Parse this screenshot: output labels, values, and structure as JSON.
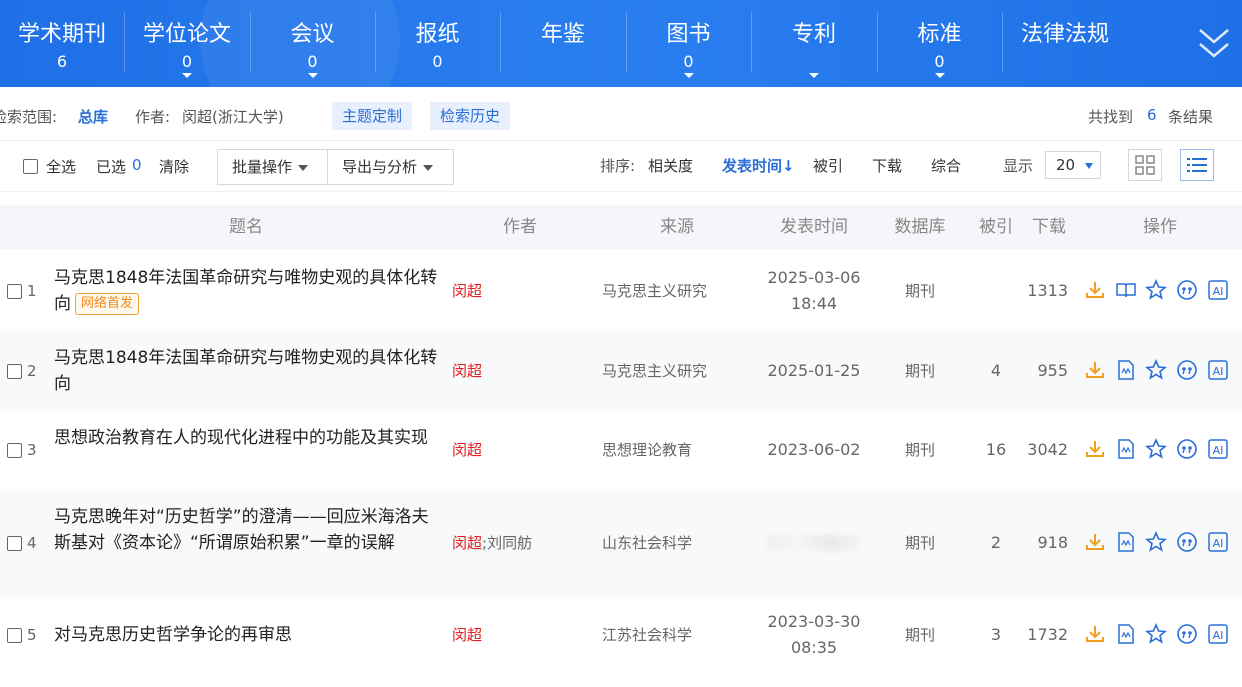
{
  "nav": {
    "tabs": [
      {
        "label": "学术期刊",
        "count": "6",
        "caret": false
      },
      {
        "label": "学位论文",
        "count": "0",
        "caret": true
      },
      {
        "label": "会议",
        "count": "0",
        "caret": true
      },
      {
        "label": "报纸",
        "count": "0",
        "caret": false
      },
      {
        "label": "年鉴",
        "count": "",
        "caret": false
      },
      {
        "label": "图书",
        "count": "0",
        "caret": true
      },
      {
        "label": "专利",
        "count": "",
        "caret": true
      },
      {
        "label": "标准",
        "count": "0",
        "caret": true
      },
      {
        "label": "法律法规",
        "count": "",
        "caret": false
      }
    ],
    "expand_icon": "double-chevron-down-icon"
  },
  "scope": {
    "label": "检索范围:",
    "value": "总库",
    "author_label": "作者:",
    "author_value": "闵超(浙江大学)",
    "topic_button": "主题定制",
    "history_button": "检索历史",
    "result_prefix": "共找到",
    "result_count": "6",
    "result_suffix": "条结果"
  },
  "toolbar": {
    "select_all": "全选",
    "selected_label": "已选",
    "selected_count": "0",
    "clear": "清除",
    "batch": "批量操作",
    "export": "导出与分析",
    "sort_label": "排序:",
    "sort_relevance": "相关度",
    "sort_time": "发表时间",
    "sort_time_arrow": "↓",
    "sort_cited": "被引",
    "sort_download": "下载",
    "sort_composite": "综合",
    "display_label": "显示",
    "page_size": "20",
    "grid_view_icon": "grid-view-icon",
    "list_view_icon": "list-view-icon"
  },
  "table": {
    "headers": {
      "title": "题名",
      "author": "作者",
      "source": "来源",
      "date": "发表时间",
      "db": "数据库",
      "cited": "被引",
      "download": "下载",
      "ops": "操作"
    },
    "rows": [
      {
        "num": "1",
        "title": "马克思1848年法国革命研究与唯物史观的具体化转向",
        "badge": "网络首发",
        "author": "闵超",
        "coauthor": "",
        "source": "马克思主义研究",
        "date": "2025-03-06",
        "time": "18:44",
        "db": "期刊",
        "cited": "",
        "download": "1313",
        "read_icon": "book-read-icon"
      },
      {
        "num": "2",
        "title": "马克思1848年法国革命研究与唯物史观的具体化转向",
        "badge": "",
        "author": "闵超",
        "coauthor": "",
        "source": "马克思主义研究",
        "date": "2025-01-25",
        "time": "",
        "db": "期刊",
        "cited": "4",
        "download": "955",
        "read_icon": "html-read-icon"
      },
      {
        "num": "3",
        "title": "思想政治教育在人的现代化进程中的功能及其实现",
        "badge": "",
        "author": "闵超",
        "coauthor": "",
        "source": "思想理论教育",
        "date": "2023-06-02",
        "time": "",
        "db": "期刊",
        "cited": "16",
        "download": "3042",
        "read_icon": "html-read-icon"
      },
      {
        "num": "4",
        "title": "马克思晚年对“历史哲学”的澄清——回应米海洛夫斯基对《资本论》“所谓原始积累”一章的误解",
        "badge": "",
        "author": "闵超",
        "coauthor": ";刘同舫",
        "source": "山东社会科学",
        "date": "",
        "time": "",
        "db": "期刊",
        "cited": "2",
        "download": "918",
        "read_icon": "html-read-icon"
      },
      {
        "num": "5",
        "title": "对马克思历史哲学争论的再审思",
        "badge": "",
        "author": "闵超",
        "coauthor": "",
        "source": "江苏社会科学",
        "date": "2023-03-30",
        "time": "08:35",
        "db": "期刊",
        "cited": "3",
        "download": "1732",
        "read_icon": "html-read-icon"
      }
    ],
    "op_icons": [
      "download-icon",
      "read-icon",
      "favorite-star-icon",
      "quote-icon",
      "ai-icon"
    ],
    "ai_label": "AI"
  },
  "colors": {
    "nav_bg": "#1f6fe6",
    "accent": "#2a6fd6",
    "author_red": "#e02020",
    "download_orange": "#f0a020"
  }
}
